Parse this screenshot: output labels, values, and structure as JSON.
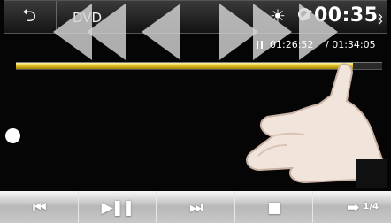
{
  "header": {
    "back_icon": "back-arrow-icon",
    "source": "DVD",
    "clock": "00:35",
    "status_icons": [
      "brightness-icon",
      "gps-icon",
      "bluetooth-icon"
    ]
  },
  "overlay": {
    "skip_icons": [
      "rewind-arrows-icon",
      "fast-forward-arrows-icon"
    ]
  },
  "playback": {
    "elapsed": "01:26:52",
    "total": "/ 01:34:05",
    "progress_fraction": 0.92,
    "colors": {
      "progress": "#e6c622",
      "track": "#2a2a2a"
    }
  },
  "controls": {
    "buttons": [
      {
        "name": "previous-button",
        "icon": "skip-previous-icon",
        "glyph": "⏮"
      },
      {
        "name": "play-pause-button",
        "icon": "play-pause-icon",
        "glyph": "▶❚❚"
      },
      {
        "name": "next-button",
        "icon": "skip-next-icon",
        "glyph": "⏭"
      },
      {
        "name": "stop-button",
        "icon": "stop-icon",
        "glyph": "■"
      },
      {
        "name": "next-page-button",
        "icon": "arrow-right-icon",
        "glyph": "➡"
      }
    ],
    "page_indicator": "1/4"
  }
}
